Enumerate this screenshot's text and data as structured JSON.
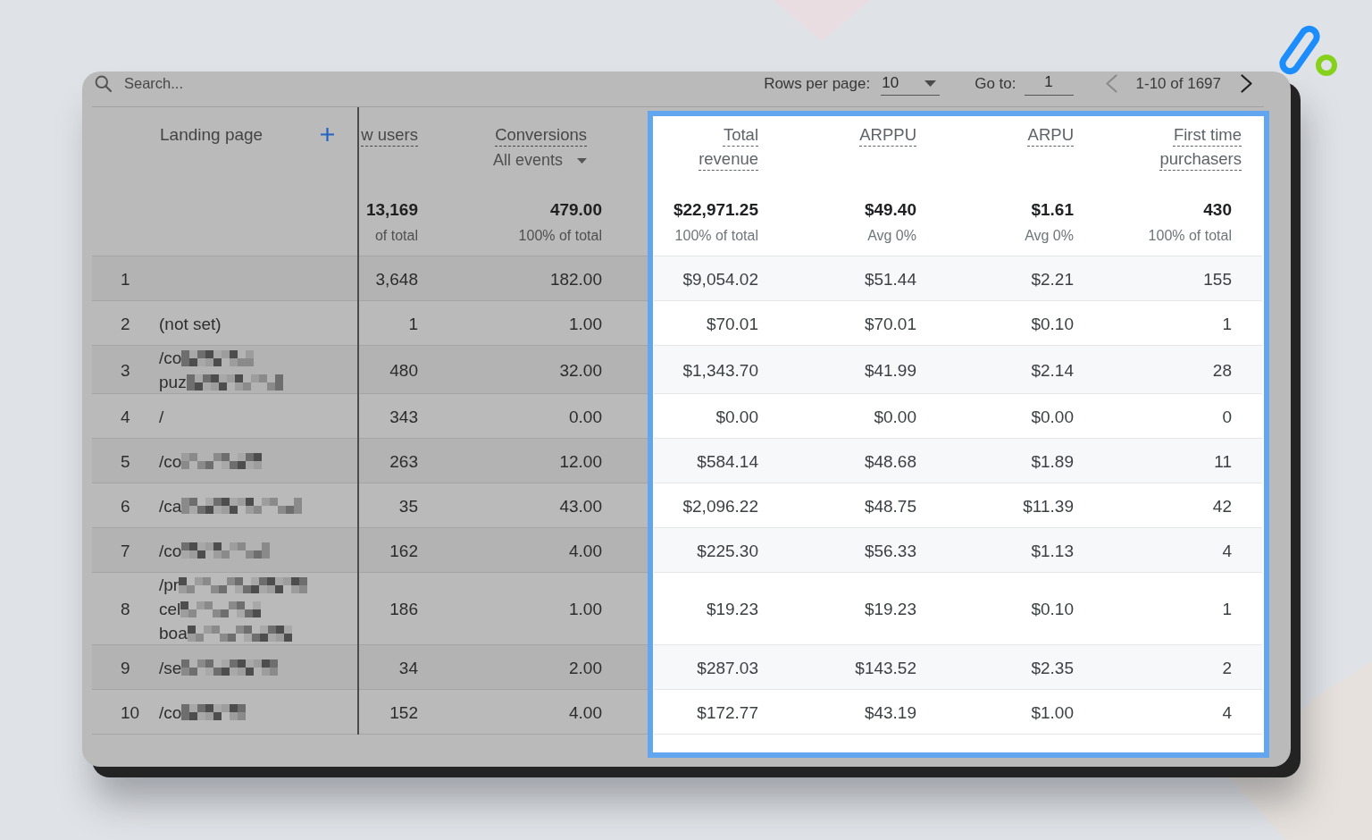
{
  "toolbar": {
    "search": {
      "placeholder": "Search..."
    },
    "rows_per_page": {
      "label": "Rows per page:",
      "value": "10"
    },
    "go_to": {
      "label": "Go to:",
      "value": "1"
    },
    "previous_page": {
      "disabled": true
    },
    "range": "1-10 of 1697",
    "next_page": {
      "disabled": false
    }
  },
  "table": {
    "dimension": {
      "label": "Landing page"
    },
    "columns": [
      {
        "label": "w users",
        "highlighted": false
      },
      {
        "label": "Conversions",
        "filter": "All events",
        "highlighted": false
      },
      {
        "label": "Total revenue",
        "highlighted": true
      },
      {
        "label": "ARPPU",
        "highlighted": true
      },
      {
        "label": "ARPU",
        "highlighted": true
      },
      {
        "label": "First time purchasers",
        "highlighted": true
      }
    ],
    "totals": [
      {
        "value": "13,169",
        "note": "of total"
      },
      {
        "value": "479.00",
        "note": "100% of total"
      },
      {
        "value": "$22,971.25",
        "note": "100% of total"
      },
      {
        "value": "$49.40",
        "note": "Avg 0%"
      },
      {
        "value": "$1.61",
        "note": "Avg 0%"
      },
      {
        "value": "430",
        "note": "100% of total"
      }
    ],
    "rows": [
      {
        "number": "1",
        "values": [
          "3,648",
          "182.00",
          "$9,054.02",
          "$51.44",
          "$2.21",
          "155"
        ]
      },
      {
        "number": "2",
        "landing_page": [
          {
            "text": "(not set)",
            "redacted": false
          }
        ],
        "values": [
          "1",
          "1.00",
          "$70.01",
          "$70.01",
          "$0.10",
          "1"
        ]
      },
      {
        "number": "3",
        "landing_page": [
          {
            "text": "/co",
            "redacted": true
          },
          {
            "text": "puz",
            "redacted": true
          }
        ],
        "values": [
          "480",
          "32.00",
          "$1,343.70",
          "$41.99",
          "$2.14",
          "28"
        ]
      },
      {
        "number": "4",
        "landing_page": [
          {
            "text": "/",
            "redacted": false
          }
        ],
        "values": [
          "343",
          "0.00",
          "$0.00",
          "$0.00",
          "$0.00",
          "0"
        ]
      },
      {
        "number": "5",
        "landing_page": [
          {
            "text": "/co",
            "redacted": true
          }
        ],
        "values": [
          "263",
          "12.00",
          "$584.14",
          "$48.68",
          "$1.89",
          "11"
        ]
      },
      {
        "number": "6",
        "landing_page": [
          {
            "text": "/ca",
            "redacted": true
          }
        ],
        "values": [
          "35",
          "43.00",
          "$2,096.22",
          "$48.75",
          "$11.39",
          "42"
        ]
      },
      {
        "number": "7",
        "landing_page": [
          {
            "text": "/co",
            "redacted": true
          }
        ],
        "values": [
          "162",
          "4.00",
          "$225.30",
          "$56.33",
          "$1.13",
          "4"
        ]
      },
      {
        "number": "8",
        "landing_page": [
          {
            "text": "/pr",
            "redacted": true
          },
          {
            "text": "cel",
            "redacted": true
          },
          {
            "text": "boa",
            "redacted": true
          }
        ],
        "values": [
          "186",
          "1.00",
          "$19.23",
          "$19.23",
          "$0.10",
          "1"
        ]
      },
      {
        "number": "9",
        "landing_page": [
          {
            "text": "/se",
            "redacted": true
          }
        ],
        "values": [
          "34",
          "2.00",
          "$287.03",
          "$143.52",
          "$2.35",
          "2"
        ]
      },
      {
        "number": "10",
        "landing_page": [
          {
            "text": "/co",
            "redacted": true
          }
        ],
        "values": [
          "152",
          "4.00",
          "$172.77",
          "$43.19",
          "$1.00",
          "4"
        ]
      }
    ]
  }
}
